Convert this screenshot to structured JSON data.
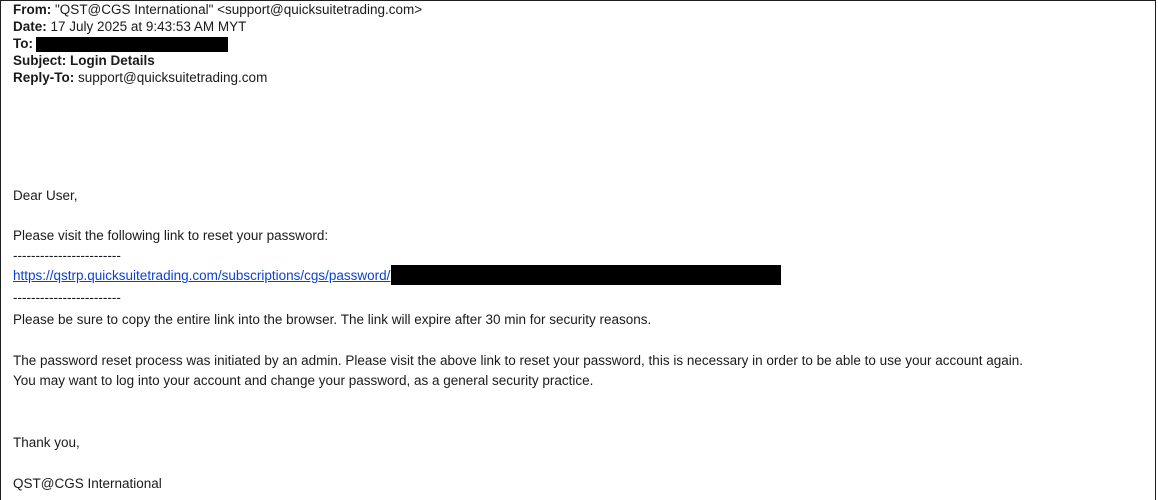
{
  "header": {
    "from_label": "From:",
    "from_value": "\"QST@CGS International\" <support@quicksuitetrading.com>",
    "date_label": "Date:",
    "date_value": "17 July 2025 at 9:43:53 AM MYT",
    "to_label": "To:",
    "subject_label": "Subject:",
    "subject_value": "Login Details",
    "replyto_label": "Reply-To:",
    "replyto_value": "support@quicksuitetrading.com"
  },
  "body": {
    "greeting": "Dear User,",
    "intro": "Please visit the following link to reset your password:",
    "separator_top": "------------------------",
    "link_text": "https://qstrp.quicksuitetrading.com/subscriptions/cgs/password/",
    "separator_bottom": "------------------------",
    "copy_notice": "Please be sure to copy the entire link into the browser. The link will expire after 30 min for security reasons.",
    "admin_notice_1": "The password reset process was initiated by an admin. Please visit the above link to reset your password, this is necessary in order to be able to use your account again.",
    "admin_notice_2": "You may want to log into your account and change your password, as a general security practice.",
    "thanks": "Thank you,",
    "signature": "QST@CGS International"
  },
  "colors": {
    "link": "#0b3fd6",
    "redaction": "#000000"
  }
}
